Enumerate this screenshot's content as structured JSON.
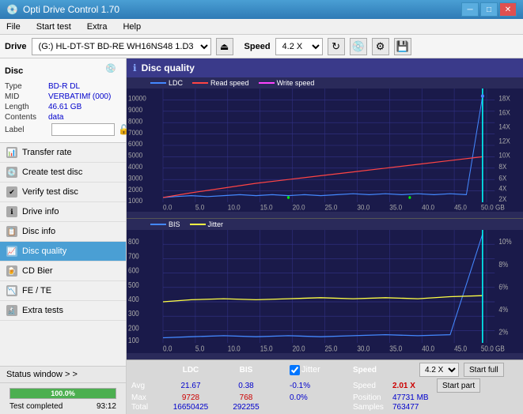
{
  "app": {
    "title": "Opti Drive Control 1.70",
    "icon": "disc-icon"
  },
  "titlebar": {
    "minimize_label": "─",
    "maximize_label": "□",
    "close_label": "✕"
  },
  "menubar": {
    "items": [
      "File",
      "Start test",
      "Extra",
      "Help"
    ]
  },
  "drivetoolbar": {
    "drive_label": "Drive",
    "drive_value": "(G:) HL-DT-ST BD-RE  WH16NS48 1.D3",
    "speed_label": "Speed",
    "speed_value": "4.2 X"
  },
  "sidebar": {
    "disc_title": "Disc",
    "disc": {
      "type_label": "Type",
      "type_value": "BD-R DL",
      "mid_label": "MID",
      "mid_value": "VERBATIMf (000)",
      "length_label": "Length",
      "length_value": "46.61 GB",
      "contents_label": "Contents",
      "contents_value": "data",
      "label_label": "Label",
      "label_value": ""
    },
    "nav_items": [
      {
        "id": "transfer-rate",
        "label": "Transfer rate",
        "active": false
      },
      {
        "id": "create-test-disc",
        "label": "Create test disc",
        "active": false
      },
      {
        "id": "verify-test-disc",
        "label": "Verify test disc",
        "active": false
      },
      {
        "id": "drive-info",
        "label": "Drive info",
        "active": false
      },
      {
        "id": "disc-info",
        "label": "Disc info",
        "active": false
      },
      {
        "id": "disc-quality",
        "label": "Disc quality",
        "active": true
      },
      {
        "id": "cd-bier",
        "label": "CD Bier",
        "active": false
      },
      {
        "id": "fe-te",
        "label": "FE / TE",
        "active": false
      },
      {
        "id": "extra-tests",
        "label": "Extra tests",
        "active": false
      }
    ],
    "status_btn_label": "Status window > >",
    "progress_pct": 100,
    "progress_label": "100.0%",
    "status_text": "Test completed",
    "status_time": "93:12"
  },
  "disc_quality": {
    "title": "Disc quality",
    "legend_top": {
      "ldc_label": "LDC",
      "read_label": "Read speed",
      "write_label": "Write speed"
    },
    "legend_bottom": {
      "bis_label": "BIS",
      "jitter_label": "Jitter"
    },
    "top_chart": {
      "y_labels": [
        "10000",
        "9000",
        "8000",
        "7000",
        "6000",
        "5000",
        "4000",
        "3000",
        "2000",
        "1000"
      ],
      "y_labels_right": [
        "18X",
        "16X",
        "14X",
        "12X",
        "10X",
        "8X",
        "6X",
        "4X",
        "2X"
      ],
      "x_labels": [
        "0.0",
        "5.0",
        "10.0",
        "15.0",
        "20.0",
        "25.0",
        "30.0",
        "35.0",
        "40.0",
        "45.0",
        "50.0 GB"
      ]
    },
    "bottom_chart": {
      "y_labels": [
        "800",
        "700",
        "600",
        "500",
        "400",
        "300",
        "200",
        "100"
      ],
      "y_labels_right": [
        "10%",
        "8%",
        "6%",
        "4%",
        "2%"
      ],
      "x_labels": [
        "0.0",
        "5.0",
        "10.0",
        "15.0",
        "20.0",
        "25.0",
        "30.0",
        "35.0",
        "40.0",
        "45.0",
        "50.0 GB"
      ]
    },
    "stats": {
      "headers": [
        "LDC",
        "BIS",
        "",
        "Jitter",
        "Speed"
      ],
      "avg_label": "Avg",
      "avg_ldc": "21.67",
      "avg_bis": "0.38",
      "avg_jitter": "-0.1%",
      "max_label": "Max",
      "max_ldc": "9728",
      "max_bis": "768",
      "max_jitter": "0.0%",
      "total_label": "Total",
      "total_ldc": "16650425",
      "total_bis": "292255",
      "jitter_checked": true,
      "jitter_label": "Jitter",
      "speed_label": "Speed",
      "speed_value": "2.01 X",
      "speed_select": "4.2 X",
      "position_label": "Position",
      "position_value": "47731 MB",
      "samples_label": "Samples",
      "samples_value": "763477",
      "start_full_label": "Start full",
      "start_part_label": "Start part"
    }
  }
}
